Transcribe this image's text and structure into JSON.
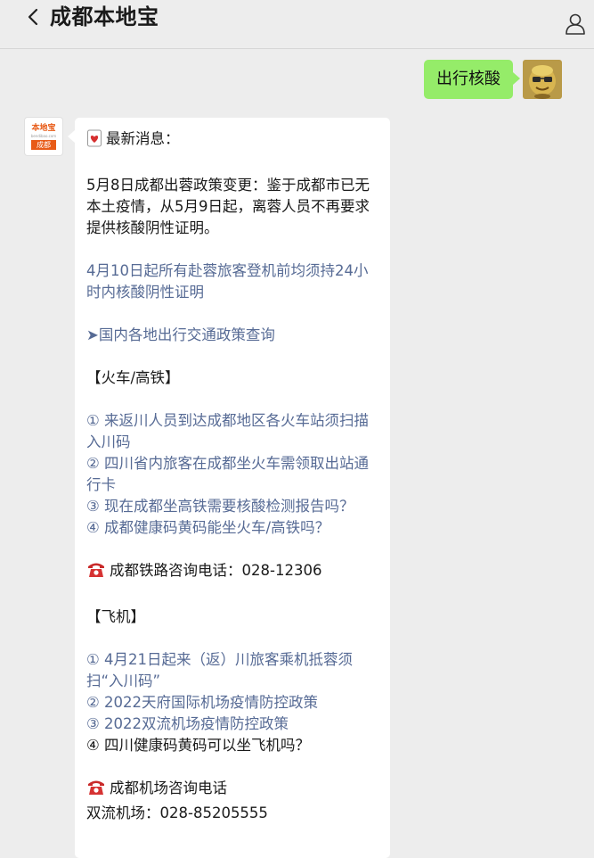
{
  "header": {
    "title": "成都本地宝"
  },
  "user_message": {
    "text": "出行核酸"
  },
  "bot_avatar": {
    "line1": "本地宝",
    "line2": "bendibao.com",
    "line3": "成都"
  },
  "reply": {
    "heading": "最新消息：",
    "policy_change": "5月8日成都出蓉政策变更：鉴于成都市已无本土疫情，从5月9日起，离蓉人员不再要求提供核酸阴性证明。",
    "flight_rule_link": "4月10日起所有赴蓉旅客登机前均须持24小时内核酸阴性证明",
    "traffic_policy_link": "➤国内各地出行交通政策查询",
    "train_section": "【火车/高铁】",
    "train_items": [
      "① 来返川人员到达成都地区各火车站须扫描入川码",
      "② 四川省内旅客在成都坐火车需领取出站通行卡",
      "③ 现在成都坐高铁需要核酸检测报告吗？",
      "④ 成都健康码黄码能坐火车/高铁吗？"
    ],
    "rail_phone": "成都铁路咨询电话：028-12306",
    "plane_section": "【飞机】",
    "plane_items": [
      "① 4月21日起来（返）川旅客乘机抵蓉须扫“入川码”",
      "② 2022天府国际机场疫情防控政策",
      "③ 2022双流机场疫情防控政策",
      "④ 四川健康码黄码可以坐飞机吗？"
    ],
    "airport_phone_title": "成都机场咨询电话",
    "shuangliu_phone": "双流机场：028-85205555"
  },
  "icons": {
    "back": "chevron-left-icon",
    "profile": "person-icon",
    "heading_emoji": "heart-card-icon",
    "phone_emoji": "telephone-icon"
  },
  "colors": {
    "background": "#ededed",
    "user_bubble": "#95ec69",
    "bot_bubble": "#ffffff",
    "link": "#576b95",
    "brand": "#e85b17"
  }
}
